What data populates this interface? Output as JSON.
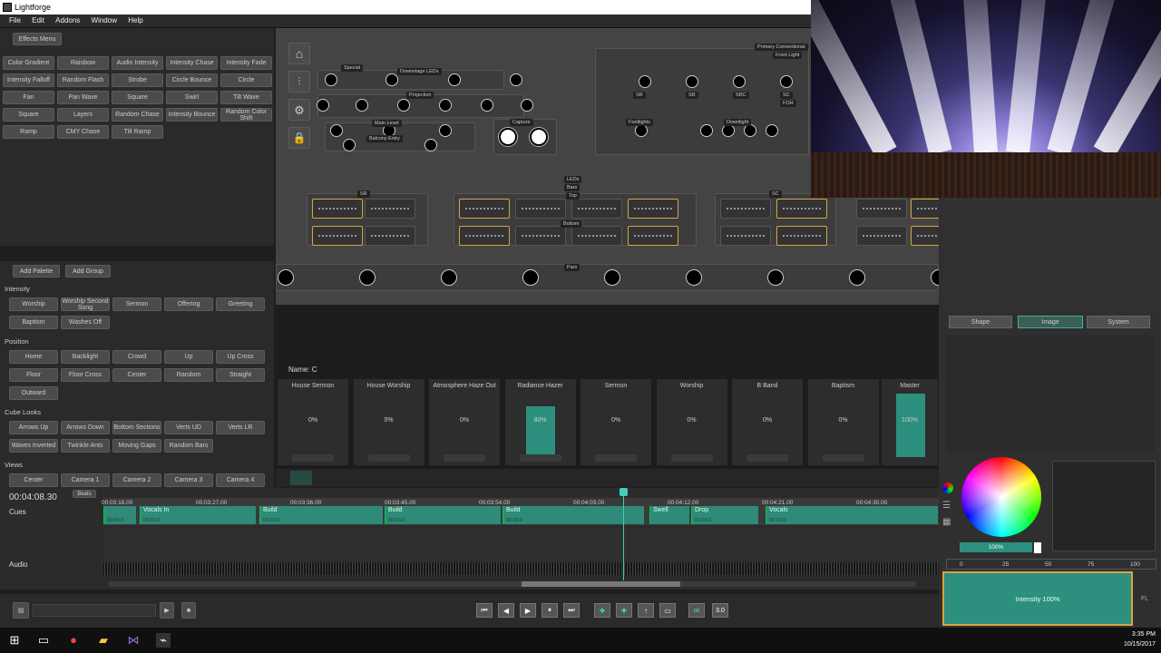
{
  "window": {
    "title": "Lightforge"
  },
  "menu": [
    "File",
    "Edit",
    "Addons",
    "Window",
    "Help"
  ],
  "effects": {
    "menu_label": "Effects Menu",
    "items": [
      "Color Gradient",
      "Rainbow",
      "Audio Intensity",
      "Intensity Chase",
      "Intensity Fade",
      "Intensity Falloff",
      "Random Flash",
      "Strobe",
      "Circle Bounce",
      "Circle",
      "Fan",
      "Pan Wave",
      "Square",
      "Swirl",
      "Tilt Wave",
      "Square",
      "Layers",
      "Random Chase",
      "Intensity Bounce",
      "Random Color Shift",
      "Ramp",
      "CMY Chase",
      "Tilt Ramp"
    ]
  },
  "palettes": {
    "add_palette": "Add Palette",
    "add_group": "Add Group",
    "groups": [
      {
        "name": "Intensity",
        "items": [
          "Worship",
          "Worship Second Song",
          "Sermon",
          "Offering",
          "Greeting",
          "Baptism",
          "Washes Off"
        ]
      },
      {
        "name": "Position",
        "items": [
          "Home",
          "Backlight",
          "Crowd",
          "Up",
          "Up Cross",
          "Floor",
          "Floor Cross",
          "Center",
          "Random",
          "Straight",
          "Outward"
        ]
      },
      {
        "name": "Cube Looks",
        "items": [
          "Arrows Up",
          "Arrows Down",
          "Bottom Sections",
          "Verts UD",
          "Verts LR",
          "Waves Inverted",
          "Twinkle Ants",
          "Moving Gaps",
          "Random Bars"
        ]
      },
      {
        "name": "Views",
        "items": [
          "Center",
          "Camera 1",
          "Camera 2",
          "Camera 3",
          "Camera 4"
        ]
      }
    ]
  },
  "stage": {
    "labels": [
      "Special",
      "Downstage LEDs",
      "Projection",
      "Main Level",
      "Balcony Entry",
      "Capture",
      "Primary Conventional",
      "Front Light",
      "SR",
      "SR",
      "SRC",
      "SC",
      "FOH",
      "Footlights",
      "Downlight",
      "LEDs",
      "Bars",
      "Top",
      "Bottom",
      "Pars",
      "SR",
      "SC"
    ]
  },
  "cue": {
    "name_label": "Name: C"
  },
  "faders": [
    {
      "name": "House Sermon",
      "value": "0%",
      "level": 0
    },
    {
      "name": "House Worship",
      "value": "0%",
      "level": 0
    },
    {
      "name": "Atmosphere Haze Out",
      "value": "0%",
      "level": 0
    },
    {
      "name": "Radiance Hazer",
      "value": "80%",
      "level": 0.8
    },
    {
      "name": "Sermon",
      "value": "0%",
      "level": 0
    },
    {
      "name": "Worship",
      "value": "0%",
      "level": 0
    },
    {
      "name": "B Band",
      "value": "0%",
      "level": 0
    },
    {
      "name": "Baptism",
      "value": "0%",
      "level": 0
    }
  ],
  "master": {
    "name": "Master",
    "value": "100%",
    "level": 1
  },
  "timeline": {
    "current_time": "00:04:08.30",
    "beats": "Beats",
    "cues_label": "Cues",
    "audio_label": "Audio",
    "ticks": [
      "00:03:18.00",
      "00:03:27.00",
      "00:03:36.00",
      "00:03:45.00",
      "00:03:54.00",
      "00:04:03.00",
      "00:04:12.00",
      "00:04:21.00",
      "00:04:30.00"
    ],
    "clips": [
      {
        "name": "",
        "time": "00:00.0"
      },
      {
        "name": "Vocals In",
        "time": "00:00.0"
      },
      {
        "name": "Build",
        "time": "00:03.0"
      },
      {
        "name": "Build",
        "time": "00:03.0"
      },
      {
        "name": "Build",
        "time": "00:03.0"
      },
      {
        "name": "Swell",
        "time": ""
      },
      {
        "name": "Drop",
        "time": "00:03.0"
      },
      {
        "name": "Vocals",
        "time": "00:03.0"
      }
    ]
  },
  "transport": {
    "rate": "3.0"
  },
  "right_panel": {
    "tabs": [
      "Shape",
      "Image",
      "System"
    ],
    "active_tab": "Image",
    "color_value": "100%",
    "scale": [
      "0",
      "25",
      "50",
      "75",
      "100"
    ],
    "intensity_label": "Intensity 100%",
    "fl": "FL"
  },
  "taskbar": {
    "time": "3:35 PM",
    "date": "10/15/2017"
  },
  "colors": {
    "accent": "#2d8f7e",
    "selected": "#d9a441"
  }
}
